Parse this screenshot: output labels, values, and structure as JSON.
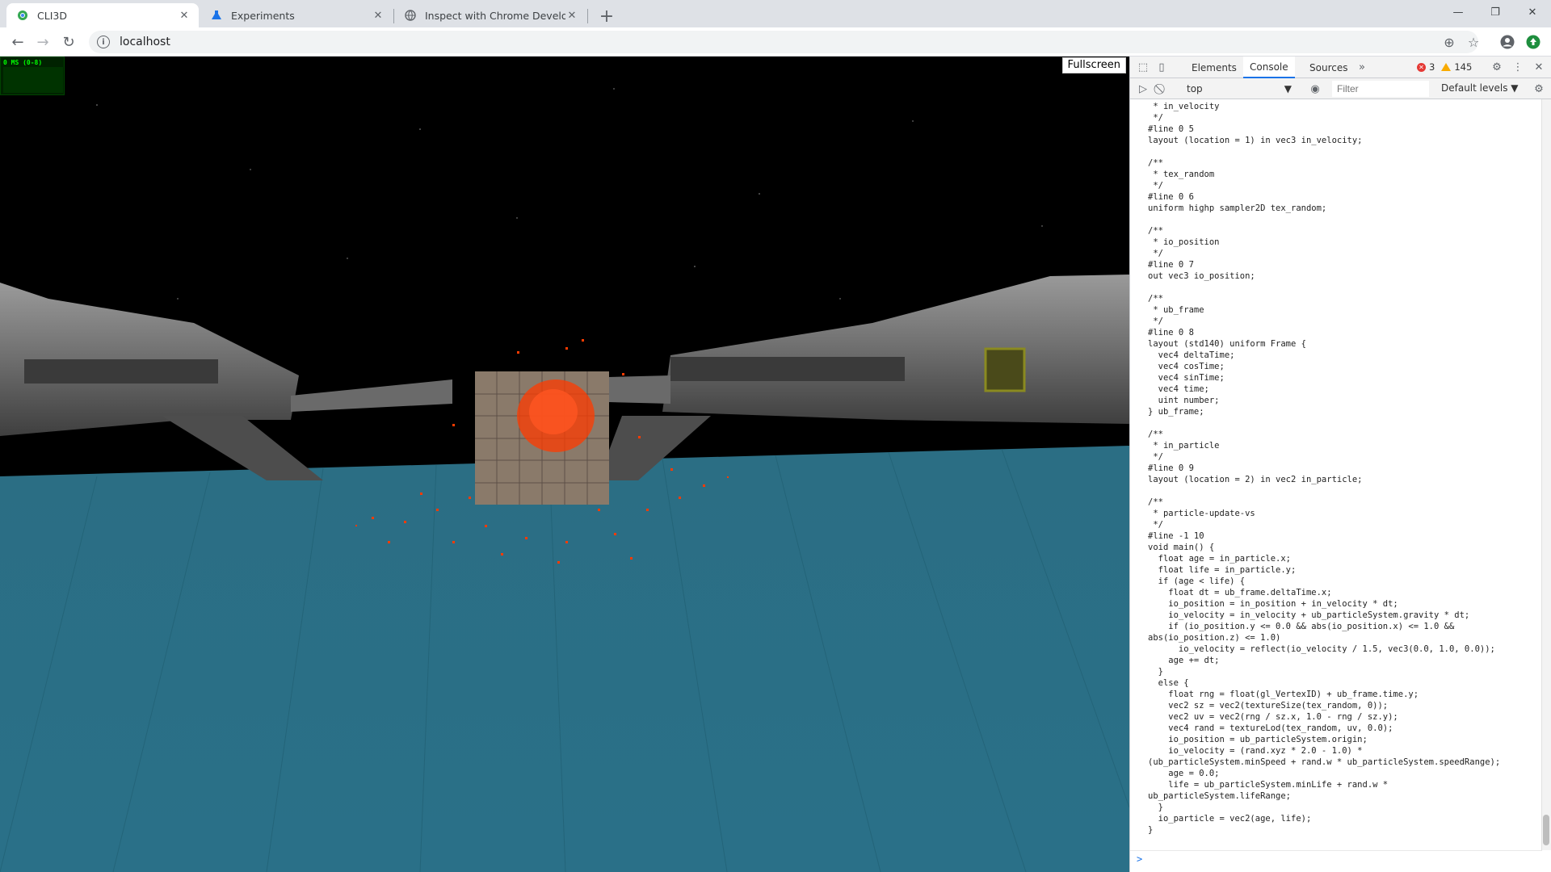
{
  "browser": {
    "tabs": [
      {
        "title": "CLI3D",
        "icon": "chrome-circle-icon",
        "active": true
      },
      {
        "title": "Experiments",
        "icon": "flask-icon",
        "active": false
      },
      {
        "title": "Inspect with Chrome Developer T",
        "icon": "globe-icon",
        "active": false
      }
    ],
    "new_tab_label": "+",
    "address": "localhost",
    "window_controls": {
      "minimize": "—",
      "restore": "❐",
      "close": "✕"
    }
  },
  "viewport": {
    "fps_label": "0 MS (0-8)",
    "fullscreen_label": "Fullscreen",
    "scene_colors": {
      "sky": "#000000",
      "water": "#2e6f86",
      "water_dark": "#1f5567",
      "hull": "#7b7b7b",
      "particles": "#ff3b00"
    }
  },
  "devtools": {
    "tabs": [
      "Elements",
      "Console",
      "Sources"
    ],
    "active_tab": "Console",
    "more_tabs": "»",
    "error_count": "3",
    "warning_count": "145",
    "context": "top",
    "filter_placeholder": "Filter",
    "levels_label": "Default levels ▼",
    "prompt_symbol": ">",
    "console_lines": [
      " * in_velocity",
      " */",
      "#line 0 5",
      "layout (location = 1) in vec3 in_velocity;",
      "",
      "/**",
      " * tex_random",
      " */",
      "#line 0 6",
      "uniform highp sampler2D tex_random;",
      "",
      "/**",
      " * io_position",
      " */",
      "#line 0 7",
      "out vec3 io_position;",
      "",
      "/**",
      " * ub_frame",
      " */",
      "#line 0 8",
      "layout (std140) uniform Frame {",
      "  vec4 deltaTime;",
      "  vec4 cosTime;",
      "  vec4 sinTime;",
      "  vec4 time;",
      "  uint number;",
      "} ub_frame;",
      "",
      "/**",
      " * in_particle",
      " */",
      "#line 0 9",
      "layout (location = 2) in vec2 in_particle;",
      "",
      "/**",
      " * particle-update-vs",
      " */",
      "#line -1 10",
      "void main() {",
      "  float age = in_particle.x;",
      "  float life = in_particle.y;",
      "  if (age < life) {",
      "    float dt = ub_frame.deltaTime.x;",
      "    io_position = in_position + in_velocity * dt;",
      "    io_velocity = in_velocity + ub_particleSystem.gravity * dt;",
      "    if (io_position.y <= 0.0 && abs(io_position.x) <= 1.0 &&",
      "abs(io_position.z) <= 1.0)",
      "      io_velocity = reflect(io_velocity / 1.5, vec3(0.0, 1.0, 0.0));",
      "    age += dt;",
      "  }",
      "  else {",
      "    float rng = float(gl_VertexID) + ub_frame.time.y;",
      "    vec2 sz = vec2(textureSize(tex_random, 0));",
      "    vec2 uv = vec2(rng / sz.x, 1.0 - rng / sz.y);",
      "    vec4 rand = textureLod(tex_random, uv, 0.0);",
      "    io_position = ub_particleSystem.origin;",
      "    io_velocity = (rand.xyz * 2.0 - 1.0) *",
      "(ub_particleSystem.minSpeed + rand.w * ub_particleSystem.speedRange);",
      "    age = 0.0;",
      "    life = ub_particleSystem.minLife + rand.w *",
      "ub_particleSystem.lifeRange;",
      "  }",
      "  io_particle = vec2(age, life);",
      "}"
    ]
  }
}
